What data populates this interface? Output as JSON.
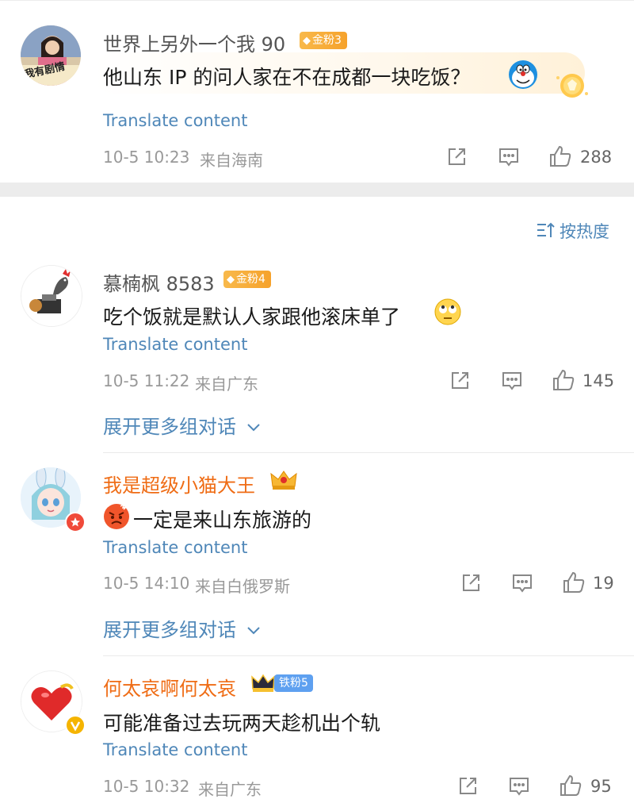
{
  "colors": {
    "link_blue": "#4f87b8",
    "username_orange": "#ef6c15",
    "gold_badge": "#f6a22b",
    "blue_badge": "#5ea0f0",
    "divider": "#ececec"
  },
  "sort": {
    "label": "按热度",
    "icon": "sort-lines-icon"
  },
  "comments": [
    {
      "username": "世界上另外一个我 90",
      "badge": "金粉3",
      "badge_icon": "gem-icon",
      "avatar_icon": "avatar-photo",
      "avatar_text": "我有剧情",
      "text": "他山东 IP 的问人家在不在成都一块吃饭？",
      "emoji": "doraemon-emoji",
      "translate": "Translate content",
      "time": "10-5 10:23",
      "location": "来自海南",
      "likes": "288"
    },
    {
      "username": "慕楠枫 8583",
      "badge": "金粉4",
      "badge_icon": "gem-icon",
      "avatar_icon": "rooster-avatar",
      "text": "吃个饭就是默认人家跟他滚床单了",
      "emoji": "eye-roll-emoji",
      "translate": "Translate content",
      "time": "10-5 11:22",
      "location": "来自广东",
      "likes": "145",
      "expand": "展开更多组对话"
    },
    {
      "username": "我是超级小猫大王",
      "badge_icon": "crown-icon",
      "avatar_icon": "anime-girl-avatar",
      "emoji": "angry-face-emoji",
      "text": "一定是来山东旅游的",
      "translate": "Translate content",
      "time": "10-5 14:10",
      "location": "来自白俄罗斯",
      "likes": "19",
      "expand": "展开更多组对话"
    },
    {
      "username": "何太哀啊何太哀",
      "badge": "铁粉5",
      "badge_icon": "crown-icon",
      "avatar_icon": "heart-avatar",
      "text": "可能准备过去玩两天趁机出个轨",
      "translate": "Translate content",
      "time": "10-5 10:32",
      "location": "来自广东",
      "likes": "95"
    }
  ]
}
